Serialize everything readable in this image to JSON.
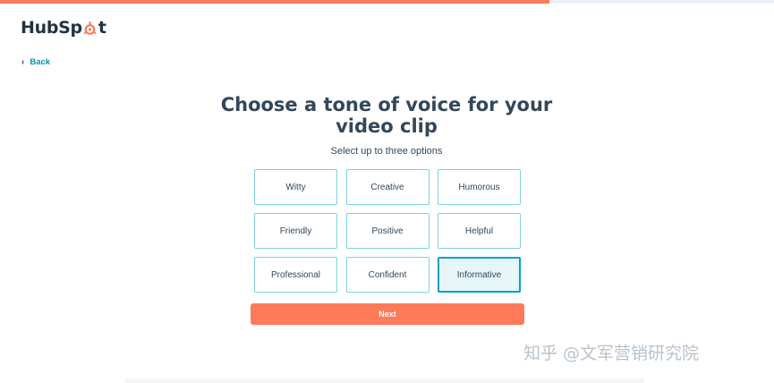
{
  "progress": {
    "fraction": 0.71,
    "color": "#ff7a59",
    "track_color": "#eaf0f6"
  },
  "brand": {
    "logo_text_before": "HubSp",
    "logo_text_after": "t",
    "logo_icon": "sprocket-icon",
    "accent": "#ff7a59"
  },
  "nav": {
    "back_label": "Back",
    "back_icon": "chevron-left-icon"
  },
  "main": {
    "title": "Choose a tone of voice for your video clip",
    "subtitle": "Select up to three options"
  },
  "options": [
    {
      "label": "Witty",
      "selected": false
    },
    {
      "label": "Creative",
      "selected": false
    },
    {
      "label": "Humorous",
      "selected": false
    },
    {
      "label": "Friendly",
      "selected": false
    },
    {
      "label": "Positive",
      "selected": false
    },
    {
      "label": "Helpful",
      "selected": false
    },
    {
      "label": "Professional",
      "selected": false
    },
    {
      "label": "Confident",
      "selected": false
    },
    {
      "label": "Informative",
      "selected": true
    }
  ],
  "actions": {
    "next_label": "Next",
    "next_color": "#ff7a59"
  },
  "watermark": {
    "text": "知乎 @文军营销研究院"
  }
}
